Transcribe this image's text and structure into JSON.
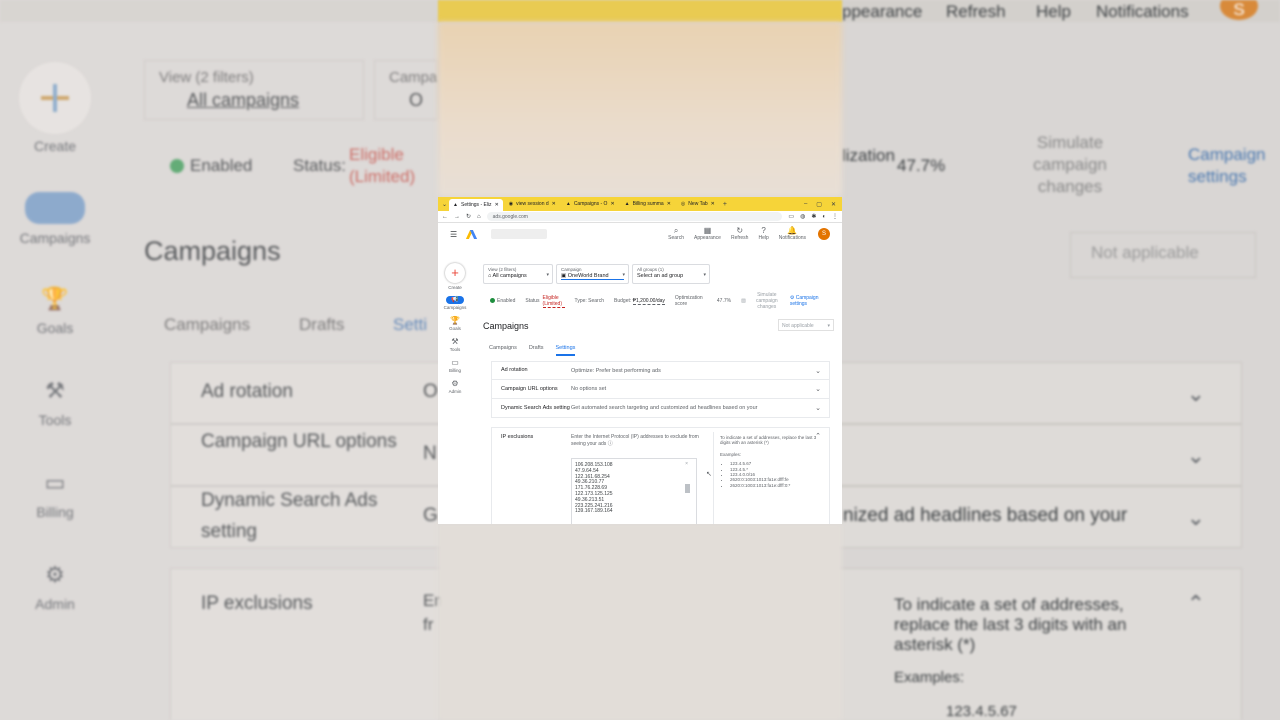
{
  "background": {
    "top_items": [
      "ppearance",
      "Refresh",
      "Help",
      "Notifications"
    ],
    "avatar_letter": "S",
    "view_label": "View (2 filters)",
    "view_value": "All campaigns",
    "campaign_label": "Campa",
    "campaign_value": "O",
    "enabled": "Enabled",
    "status_label": "Status:",
    "status_value": "Eligible (Limited)",
    "optimization_fragment": "lization",
    "optimization_value": "47.7%",
    "simulate": "Simulate campaign changes",
    "campaign_settings": "Campaign settings",
    "page_title": "Campaigns",
    "not_applicable": "Not applicable",
    "tabs": [
      "Campaigns",
      "Drafts",
      "Setti"
    ],
    "rail": [
      "Create",
      "Campaigns",
      "Goals",
      "Tools",
      "Billing",
      "Admin"
    ],
    "rows": [
      "Ad rotation",
      "Campaign URL options",
      "Dynamic Search Ads setting"
    ],
    "row_values": [
      "O",
      "N",
      "G"
    ],
    "dsa_fragment": "nized ad headlines based on your",
    "ip_title": "IP exclusions",
    "ip_desc_fragments": [
      "En",
      "fr"
    ],
    "hint": "To indicate a set of addresses, replace the last 3 digits with an asterisk (*)",
    "examples": "Examples:",
    "example1": "123.4.5.67"
  },
  "browser": {
    "tabs": [
      {
        "label": "Settings - Eliz"
      },
      {
        "label": "view session d"
      },
      {
        "label": "Campaigns - O"
      },
      {
        "label": "Billing summa"
      },
      {
        "label": "New Tab"
      }
    ],
    "url": "ads.google.com"
  },
  "app": {
    "tools": [
      {
        "icon": "⌕",
        "label": "Search"
      },
      {
        "icon": "▦",
        "label": "Appearance"
      },
      {
        "icon": "↻",
        "label": "Refresh"
      },
      {
        "icon": "?",
        "label": "Help"
      },
      {
        "icon": "🔔",
        "label": "Notifications"
      }
    ],
    "avatar": "S",
    "side": [
      "Create",
      "Campaigns",
      "Goals",
      "Tools",
      "Billing",
      "Admin"
    ],
    "view_label": "View (2 filters)",
    "view_value": "All campaigns",
    "campaign_label": "Campaign",
    "campaign_value": "OneWorld Brand",
    "adgroup_label": "All groups (1)",
    "adgroup_value": "Select an ad group",
    "enabled": "Enabled",
    "status_label": "Status",
    "status_value": "Eligible (Limited)",
    "type": "Type: Search",
    "budget_label": "Budget:",
    "budget_value": "₱1,200.00/day",
    "opt_label": "Optimization score",
    "opt_value": "47.7%",
    "simulate": "Simulate campaign changes",
    "campaign_settings": "Campaign settings",
    "page_title": "Campaigns",
    "not_applicable": "Not applicable",
    "tabs": [
      "Campaigns",
      "Drafts",
      "Settings"
    ],
    "rows": [
      {
        "key": "Ad rotation",
        "value": "Optimize: Prefer best performing ads"
      },
      {
        "key": "Campaign URL options",
        "value": "No options set"
      },
      {
        "key": "Dynamic Search Ads setting",
        "value": "Get automated search targeting and customized ad headlines based on your"
      }
    ],
    "ip": {
      "title": "IP exclusions",
      "desc": "Enter the Internet Protocol (IP) addresses to exclude from seeing your ads",
      "addresses": [
        "106.208.153.108",
        "47.9.64.54",
        "122.161.68.254",
        "49.36.210.77",
        "171.76.228.69",
        "122.173.125.125",
        "49.36.213.51",
        "223.225.241.216",
        "139.167.189.164"
      ],
      "hint": "To indicate a set of addresses, replace the last 3 digits with an asterisk (*)",
      "examples_label": "Examples:",
      "examples": [
        "123.4.5.67",
        "123.4.5.*",
        "123.4.0.0/16",
        "2620:0:1003:1013:fa1e:dfff:fe",
        "2620:0:1003:1013:fa1e:dfff:0:*"
      ]
    }
  }
}
